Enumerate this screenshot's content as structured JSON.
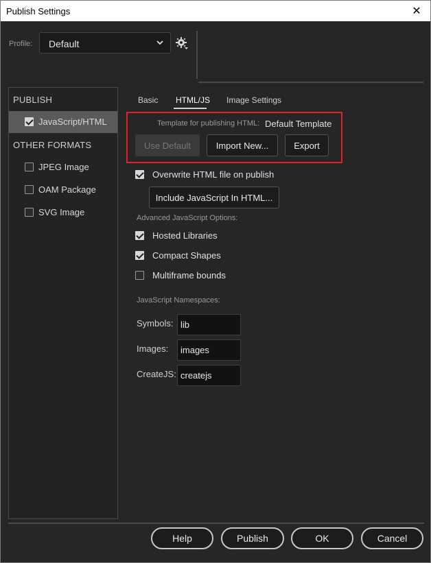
{
  "window": {
    "title": "Publish Settings",
    "close_glyph": "✕"
  },
  "profile": {
    "label": "Profile:",
    "value": "Default"
  },
  "sidebar": {
    "publish_header": "PUBLISH",
    "publish_items": [
      {
        "label": "JavaScript/HTML",
        "checked": true
      }
    ],
    "other_header": "OTHER FORMATS",
    "other_items": [
      {
        "label": "JPEG Image",
        "checked": false
      },
      {
        "label": "OAM Package",
        "checked": false
      },
      {
        "label": "SVG Image",
        "checked": false
      }
    ]
  },
  "tabs": [
    {
      "label": "Basic"
    },
    {
      "label": "HTML/JS"
    },
    {
      "label": "Image Settings"
    }
  ],
  "template": {
    "label": "Template for publishing HTML:",
    "value": "Default Template",
    "use_default": "Use Default",
    "import_new": "Import New...",
    "export": "Export"
  },
  "overwrite": {
    "label": "Overwrite HTML file on publish",
    "checked": true
  },
  "include_js": "Include JavaScript In HTML...",
  "advanced": {
    "header": "Advanced JavaScript Options:",
    "options": [
      {
        "label": "Hosted Libraries",
        "checked": true
      },
      {
        "label": "Compact Shapes",
        "checked": true
      },
      {
        "label": "Multiframe bounds",
        "checked": false
      }
    ]
  },
  "namespaces": {
    "header": "JavaScript Namespaces:",
    "symbols_label": "Symbols:",
    "symbols_value": "lib",
    "images_label": "Images:",
    "images_value": "images",
    "createjs_label": "CreateJS:",
    "createjs_value": "createjs"
  },
  "footer": {
    "help": "Help",
    "publish": "Publish",
    "ok": "OK",
    "cancel": "Cancel"
  },
  "colors": {
    "highlight_box": "#e0202a",
    "panel_bg": "#262626",
    "selected_item": "#5a5a5a"
  }
}
